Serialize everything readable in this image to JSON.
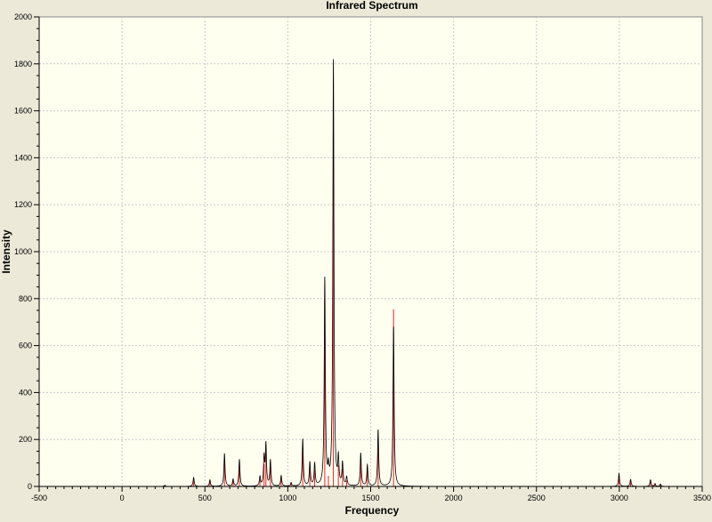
{
  "chart_data": {
    "type": "line",
    "title": "Infrared Spectrum",
    "xlabel": "Frequency",
    "ylabel": "Intensity",
    "xlim": [
      -500,
      3500
    ],
    "ylim": [
      0,
      2000
    ],
    "x_ticks": [
      "-500",
      "0",
      "500",
      "1000",
      "1500",
      "2000",
      "2500",
      "3000",
      "3500"
    ],
    "y_ticks": [
      "0",
      "200",
      "400",
      "600",
      "800",
      "1000",
      "1200",
      "1400",
      "1600",
      "1800",
      "2000"
    ],
    "grid": true,
    "series": [
      {
        "kind": "envelope",
        "color": "#000000",
        "x_range": [
          0,
          3270
        ],
        "peaks": [
          [
            258,
            5
          ],
          [
            432,
            38
          ],
          [
            530,
            28
          ],
          [
            618,
            140
          ],
          [
            670,
            30
          ],
          [
            708,
            115
          ],
          [
            832,
            40
          ],
          [
            857,
            120
          ],
          [
            868,
            175
          ],
          [
            895,
            110
          ],
          [
            960,
            45
          ],
          [
            1020,
            15
          ],
          [
            1090,
            200
          ],
          [
            1133,
            100
          ],
          [
            1162,
            95
          ],
          [
            1223,
            880
          ],
          [
            1245,
            60
          ],
          [
            1275,
            1810
          ],
          [
            1305,
            110
          ],
          [
            1330,
            95
          ],
          [
            1355,
            35
          ],
          [
            1440,
            140
          ],
          [
            1480,
            90
          ],
          [
            1545,
            240
          ],
          [
            1638,
            680
          ],
          [
            2998,
            55
          ],
          [
            3068,
            30
          ],
          [
            3188,
            28
          ],
          [
            3215,
            12
          ],
          [
            3248,
            10
          ]
        ]
      },
      {
        "kind": "stick",
        "color": "#e8242a",
        "values": [
          [
            258,
            5
          ],
          [
            432,
            30
          ],
          [
            530,
            22
          ],
          [
            618,
            110
          ],
          [
            670,
            25
          ],
          [
            708,
            90
          ],
          [
            832,
            30
          ],
          [
            857,
            95
          ],
          [
            868,
            150
          ],
          [
            895,
            85
          ],
          [
            960,
            35
          ],
          [
            1020,
            12
          ],
          [
            1090,
            160
          ],
          [
            1133,
            80
          ],
          [
            1162,
            70
          ],
          [
            1223,
            800
          ],
          [
            1245,
            45
          ],
          [
            1275,
            1490
          ],
          [
            1305,
            90
          ],
          [
            1330,
            75
          ],
          [
            1355,
            25
          ],
          [
            1440,
            120
          ],
          [
            1480,
            70
          ],
          [
            1545,
            210
          ],
          [
            1638,
            755
          ],
          [
            2998,
            45
          ],
          [
            3068,
            22
          ],
          [
            3188,
            22
          ],
          [
            3215,
            10
          ],
          [
            3248,
            8
          ]
        ]
      }
    ]
  }
}
